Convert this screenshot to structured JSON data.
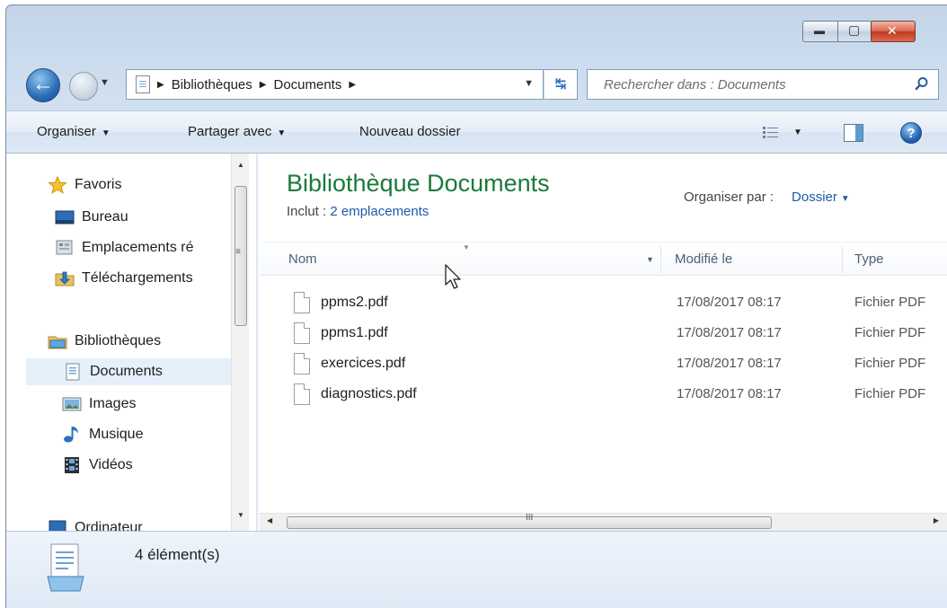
{
  "window": {
    "minimize_glyph": "▬",
    "maximize_glyph": "▢",
    "close_glyph": "✕"
  },
  "nav": {
    "back_glyph": "←",
    "breadcrumb": [
      "Bibliothèques",
      "Documents"
    ],
    "search_placeholder": "Rechercher dans : Documents"
  },
  "toolbar": {
    "organize": "Organiser",
    "share": "Partager avec",
    "new_folder": "Nouveau dossier",
    "help_glyph": "?"
  },
  "sidebar": {
    "favorites": "Favoris",
    "desktop": "Bureau",
    "recent_places": "Emplacements ré",
    "downloads": "Téléchargements",
    "libraries": "Bibliothèques",
    "documents": "Documents",
    "images": "Images",
    "music": "Musique",
    "videos": "Vidéos",
    "computer": "Ordinateur"
  },
  "library": {
    "title": "Bibliothèque Documents",
    "include_prefix": "Inclut : ",
    "include_link": "2 emplacements",
    "arrange_label": "Organiser par :",
    "arrange_value": "Dossier"
  },
  "columns": {
    "name": "Nom",
    "modified": "Modifié le",
    "type": "Type"
  },
  "files": [
    {
      "name": "ppms2.pdf",
      "modified": "17/08/2017 08:17",
      "type": "Fichier PDF"
    },
    {
      "name": "ppms1.pdf",
      "modified": "17/08/2017 08:17",
      "type": "Fichier PDF"
    },
    {
      "name": "exercices.pdf",
      "modified": "17/08/2017 08:17",
      "type": "Fichier PDF"
    },
    {
      "name": "diagnostics.pdf",
      "modified": "17/08/2017 08:17",
      "type": "Fichier PDF"
    }
  ],
  "status": {
    "count": "4 élément(s)"
  },
  "colors": {
    "title_green": "#1b7a3a",
    "link_blue": "#1e5aa8",
    "selection": "#e5f0fb"
  }
}
